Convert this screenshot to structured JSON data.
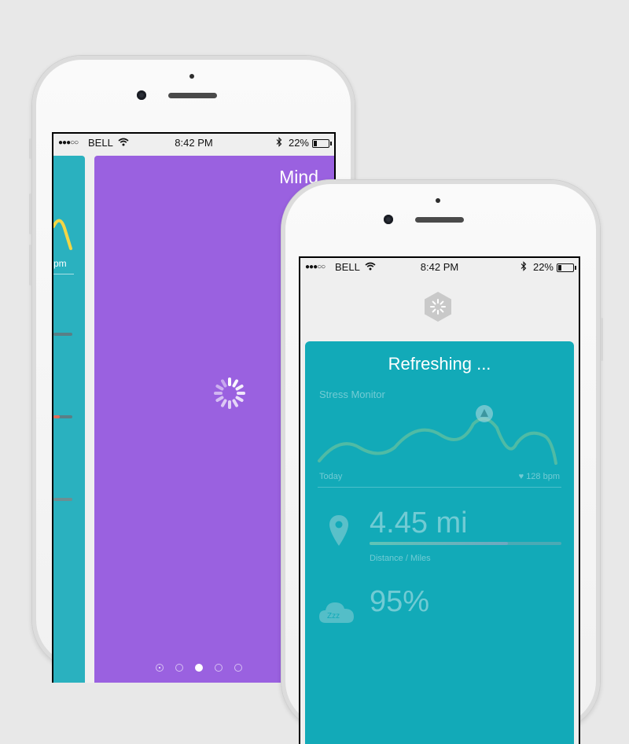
{
  "colors": {
    "background": "#e8e8e8",
    "purple_card": "#9a61e0",
    "teal_card": "#12aab8",
    "teal_strip": "#2ab1bf"
  },
  "back_phone": {
    "status_bar": {
      "signal": "●●●○○",
      "carrier": "BELL",
      "wifi_icon": "wifi-icon",
      "time": "8:42 PM",
      "bluetooth_icon": "bluetooth-icon",
      "battery": "22%",
      "battery_level": 0.22
    },
    "card_title": "Mind",
    "left_strip_text": "pm",
    "page_dots": {
      "count": 5,
      "active_index": 2,
      "first_icon": "location-icon"
    }
  },
  "front_phone": {
    "status_bar": {
      "signal": "●●●○○",
      "carrier": "BELL",
      "wifi_icon": "wifi-icon",
      "time": "8:42 PM",
      "bluetooth_icon": "bluetooth-icon",
      "battery": "22%",
      "battery_level": 0.22
    },
    "logo_icon": "hexagon-spinner-logo",
    "refresh_title": "Refreshing ...",
    "stress_monitor": {
      "label": "Stress Monitor",
      "today": "Today",
      "bpm": "128 bpm",
      "alert_icon": "warning-icon"
    },
    "distance": {
      "value": "4.45 mi",
      "label": "Distance / Miles",
      "progress": 0.72,
      "icon": "location-pin-icon"
    },
    "sleep": {
      "value": "95%",
      "icon": "sleep-cloud-icon",
      "icon_text": "Zzz"
    }
  }
}
